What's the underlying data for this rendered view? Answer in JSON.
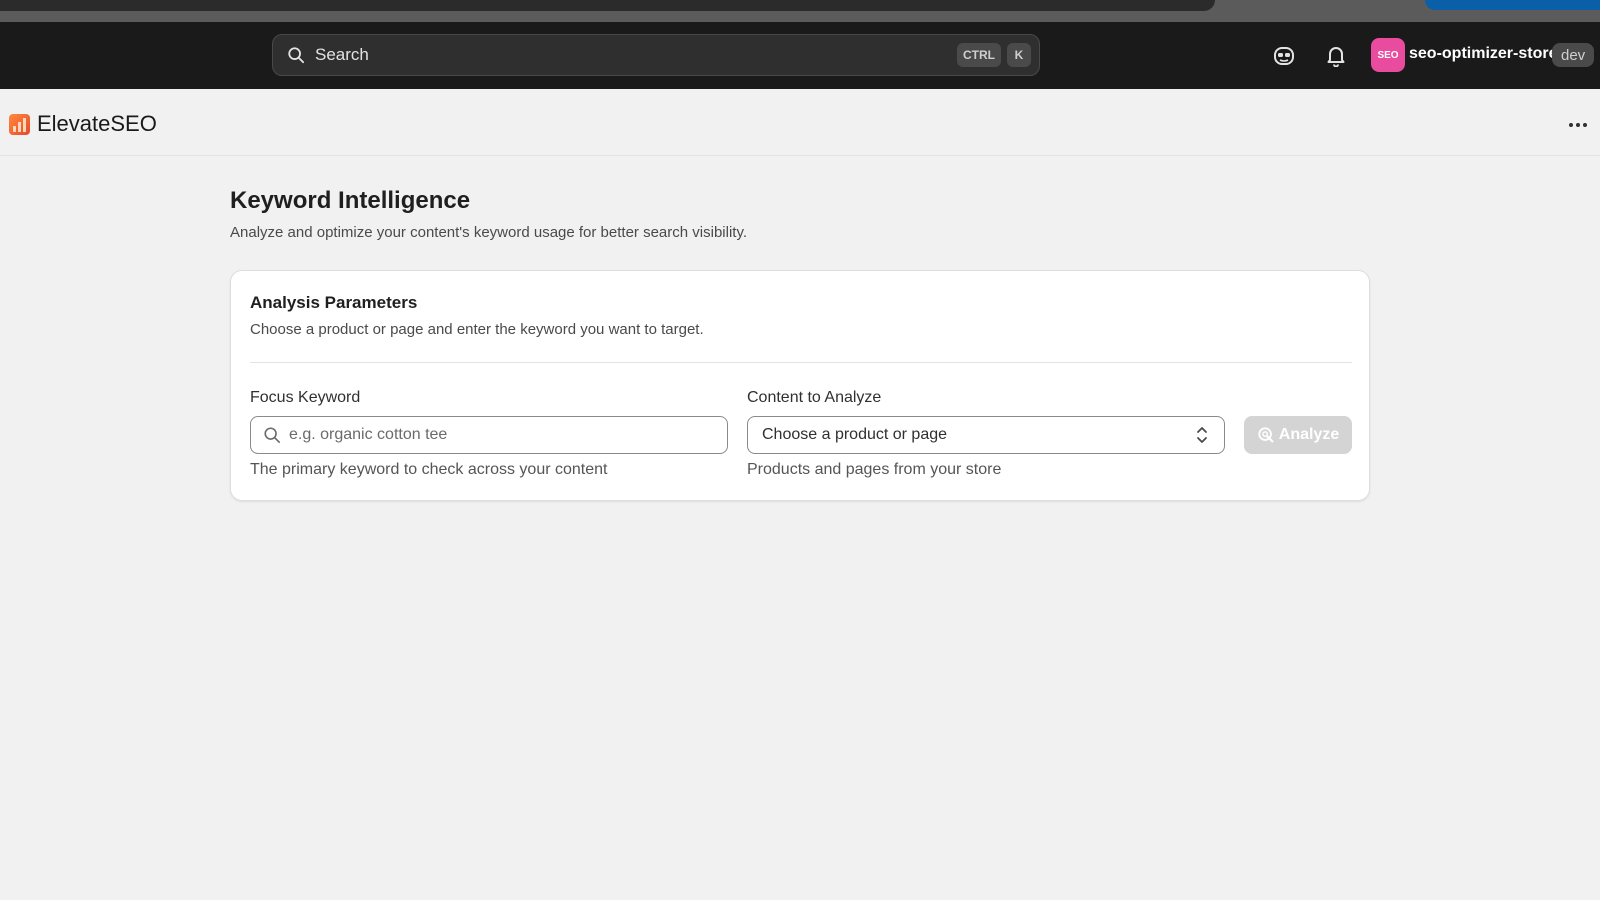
{
  "topbar": {
    "search_label": "Search",
    "shortcut_ctrl": "CTRL",
    "shortcut_k": "K",
    "store_avatar_text": "SEO",
    "store_name": "seo-optimizer-store",
    "env_badge": "dev",
    "icons": [
      "search-icon",
      "sidekick-icon",
      "bell-icon"
    ]
  },
  "app": {
    "title": "ElevateSEO",
    "logo_icon": "chart-bars-icon",
    "more_icon": "ellipsis-icon"
  },
  "page": {
    "title": "Keyword Intelligence",
    "subtitle": "Analyze and optimize your content's keyword usage for better search visibility."
  },
  "card": {
    "title": "Analysis Parameters",
    "description": "Choose a product or page and enter the keyword you want to target.",
    "keyword_label": "Focus Keyword",
    "keyword_placeholder": "e.g. organic cotton tee",
    "keyword_value": "",
    "keyword_help": "The primary keyword to check across your content",
    "content_label": "Content to Analyze",
    "content_selected": "Choose a product or page",
    "content_help": "Products and pages from your store",
    "analyze_label": "Analyze",
    "analyze_disabled": true
  },
  "colors": {
    "topbar_bg": "#1a1a1a",
    "page_bg": "#f1f1f1",
    "store_avatar_bg": "#e94b9f",
    "button_disabled_bg": "#d4d4d4",
    "logo_gradient_start": "#ff8a3d",
    "logo_gradient_end": "#e5492b"
  }
}
